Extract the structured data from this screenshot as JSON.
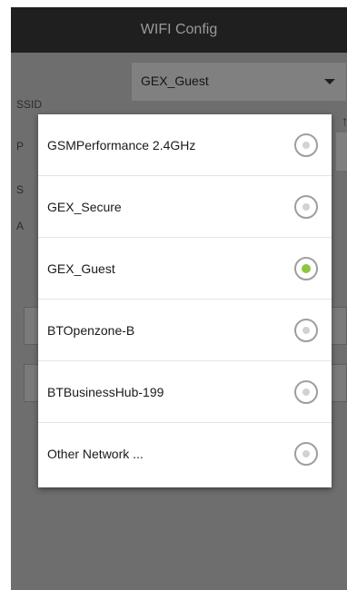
{
  "header": {
    "title": "WIFI Config"
  },
  "form": {
    "ssid_label": "SSID",
    "ssid_selected": "GEX_Guest",
    "hidden_label_initials": [
      "P",
      "S",
      "A"
    ]
  },
  "dialog": {
    "options": [
      {
        "label": "GSMPerformance 2.4GHz",
        "selected": false
      },
      {
        "label": "GEX_Secure",
        "selected": false
      },
      {
        "label": "GEX_Guest",
        "selected": true
      },
      {
        "label": "BTOpenzone-B",
        "selected": false
      },
      {
        "label": "BTBusinessHub-199",
        "selected": false
      },
      {
        "label": "Other Network ...",
        "selected": false
      }
    ]
  },
  "colors": {
    "titlebar_bg": "#1f1f1f",
    "dim_bg": "#6e6e6e",
    "radio_selected": "#8dc63f",
    "radio_border": "#9e9e9e"
  },
  "icons": {
    "dropdown": "chevron-down-icon",
    "radio_on": "radio-checked-icon",
    "radio_off": "radio-unchecked-icon"
  }
}
